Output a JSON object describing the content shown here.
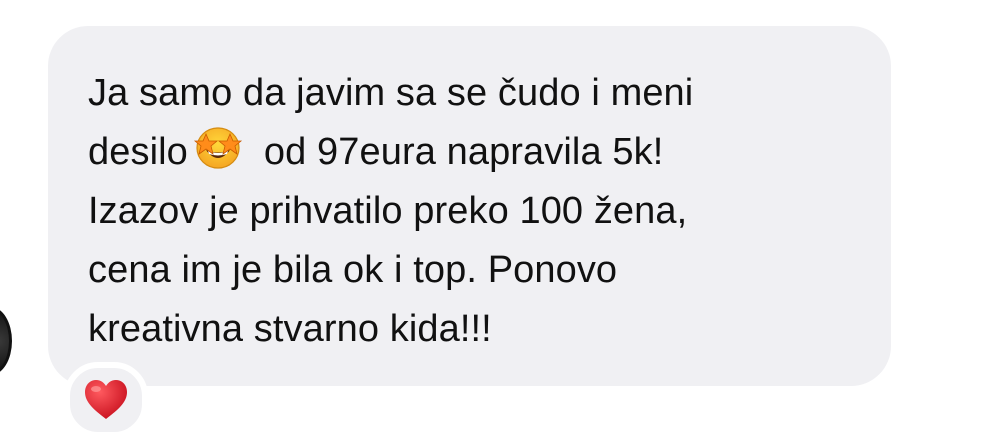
{
  "message": {
    "lines": [
      "Ja samo da javim sa se čudo i meni",
      "desilo",
      "od 97eura napravila 5k!",
      "Izazov je prihvatilo preko 100 žena,",
      "cena im je bila ok i top. Ponovo",
      "kreativna stvarno kida!!!"
    ],
    "inline_emoji": "star-struck-emoji",
    "bubble_color": "#f0f0f3",
    "text_color": "#111111"
  },
  "reaction": {
    "emoji": "red-heart",
    "color": "#e0202e"
  }
}
